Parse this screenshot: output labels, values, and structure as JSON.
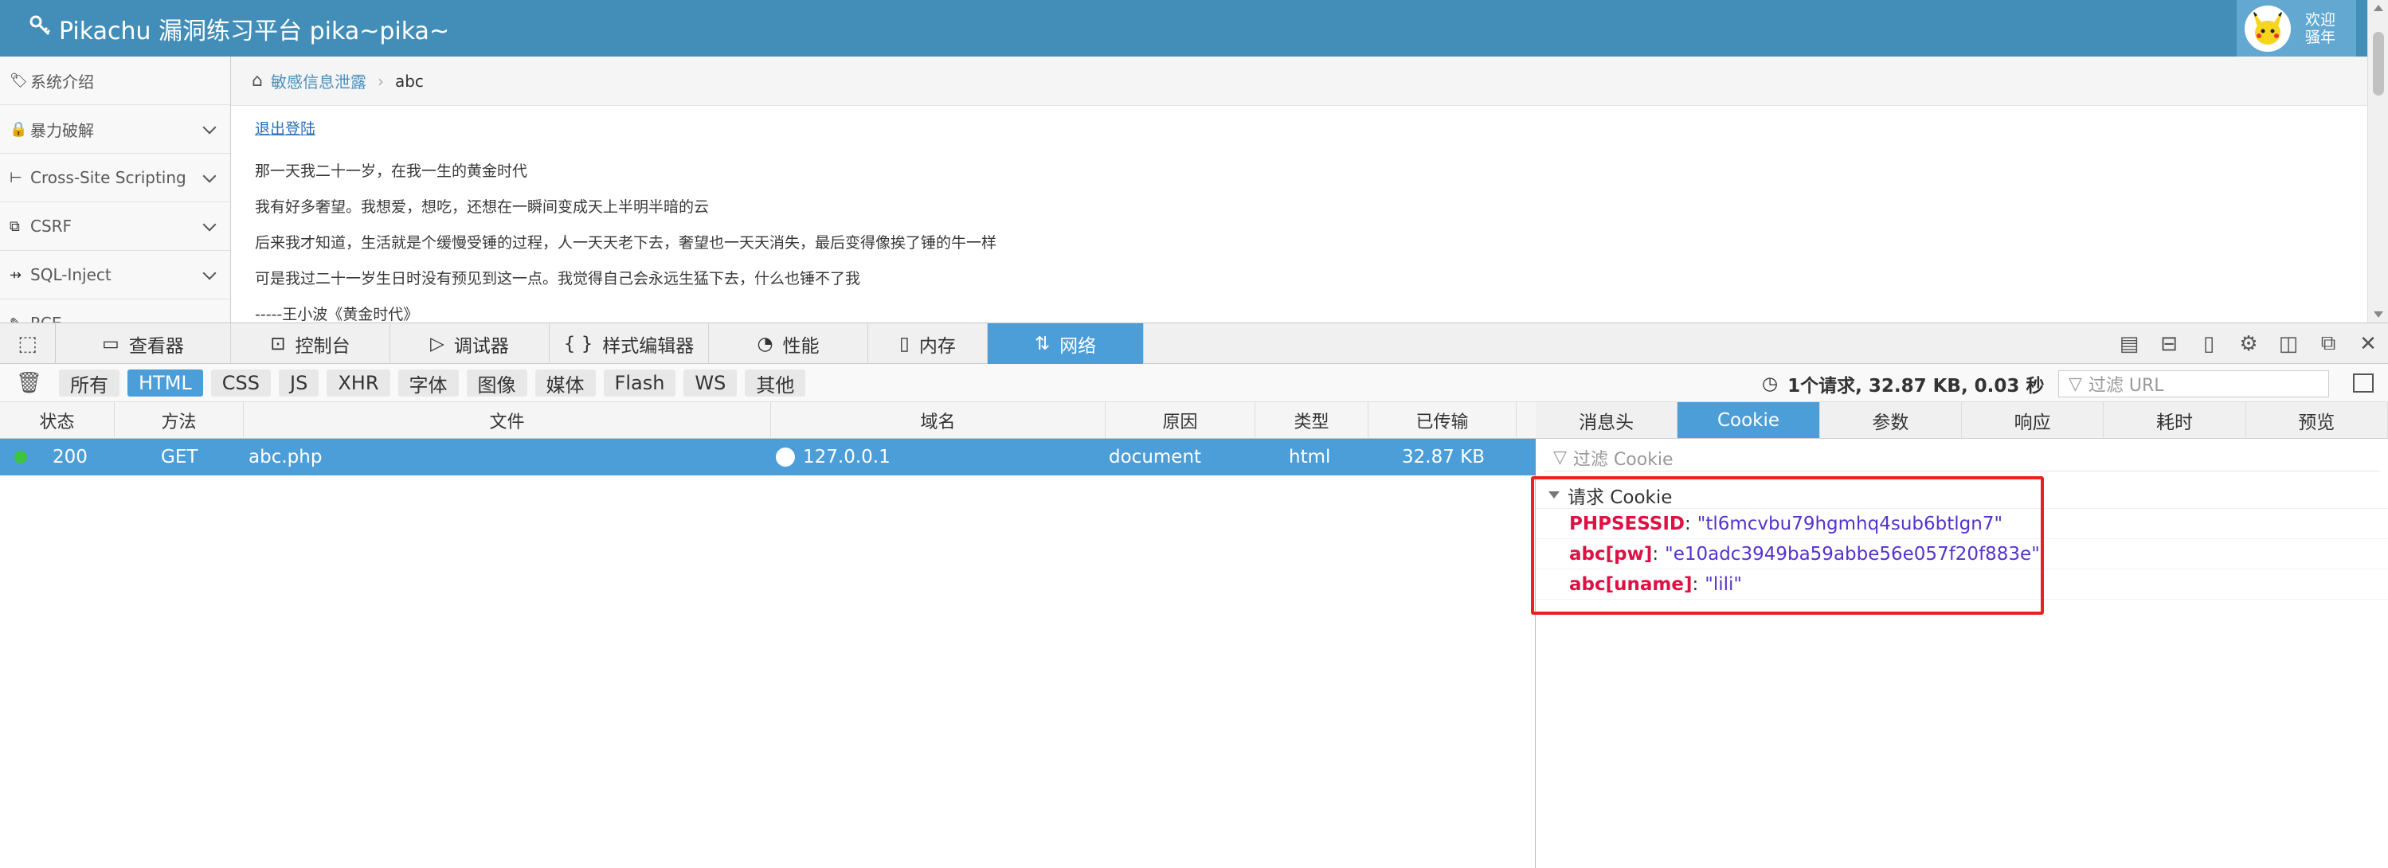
{
  "page": {
    "brand": "Pikachu 漏洞练习平台 pika~pika~",
    "user": {
      "welcome_line1": "欢迎",
      "welcome_line2": "骚年"
    },
    "sidebar": [
      {
        "label": "系统介绍",
        "icon": "tag-icon",
        "chevron": false
      },
      {
        "label": "暴力破解",
        "icon": "lock-icon",
        "chevron": true
      },
      {
        "label": "Cross-Site Scripting",
        "icon": "tree-icon",
        "chevron": true
      },
      {
        "label": "CSRF",
        "icon": "share-icon",
        "chevron": true
      },
      {
        "label": "SQL-Inject",
        "icon": "needle-icon",
        "chevron": true
      },
      {
        "label": "RCE",
        "icon": "wrench-icon",
        "chevron": false
      }
    ],
    "breadcrumb": {
      "parent": "敏感信息泄露",
      "current": "abc"
    },
    "content": {
      "logout": "退出登陆",
      "lines": [
        "那一天我二十一岁，在我一生的黄金时代",
        "我有好多奢望。我想爱，想吃，还想在一瞬间变成天上半明半暗的云",
        "后来我才知道，生活就是个缓慢受锤的过程，人一天天老下去，奢望也一天天消失，最后变得像挨了锤的牛一样",
        "可是我过二十一岁生日时没有预见到这一点。我觉得自己会永远生猛下去，什么也锤不了我",
        "-----王小波《黄金时代》"
      ]
    }
  },
  "devtools": {
    "tabs": [
      {
        "label": "查看器",
        "icon": "inspector-icon"
      },
      {
        "label": "控制台",
        "icon": "console-icon"
      },
      {
        "label": "调试器",
        "icon": "debugger-icon"
      },
      {
        "label": "样式编辑器",
        "icon": "style-editor-icon"
      },
      {
        "label": "性能",
        "icon": "performance-icon"
      },
      {
        "label": "内存",
        "icon": "memory-icon"
      },
      {
        "label": "网络",
        "icon": "network-icon",
        "active": true
      }
    ],
    "filters": [
      "所有",
      "HTML",
      "CSS",
      "JS",
      "XHR",
      "字体",
      "图像",
      "媒体",
      "Flash",
      "WS",
      "其他"
    ],
    "active_filter": "HTML",
    "summary": "1个请求, 32.87 KB, 0.03 秒",
    "url_filter_placeholder": "过滤 URL",
    "columns": [
      "状态",
      "方法",
      "文件",
      "域名",
      "原因",
      "类型",
      "已传输"
    ],
    "request": {
      "status": "200",
      "method": "GET",
      "file": "abc.php",
      "domain": "127.0.0.1",
      "cause": "document",
      "type": "html",
      "transferred": "32.87 KB"
    },
    "detail_tabs": [
      "消息头",
      "Cookie",
      "参数",
      "响应",
      "耗时",
      "预览"
    ],
    "active_detail_tab": "Cookie",
    "cookie_filter_placeholder": "过滤 Cookie",
    "cookie_section_title": "请求 Cookie",
    "cookies": [
      {
        "name": "PHPSESSID",
        "value": "\"tl6mcvbu79hgmhq4sub6btlgn7\""
      },
      {
        "name": "abc[pw]",
        "value": "\"e10adc3949ba59abbe56e057f20f883e\""
      },
      {
        "name": "abc[uname]",
        "value": "\"lili\""
      }
    ],
    "colors": {
      "accent": "#4c9ed9",
      "topbar": "#438eb9",
      "highlight": "#e8231f"
    }
  }
}
